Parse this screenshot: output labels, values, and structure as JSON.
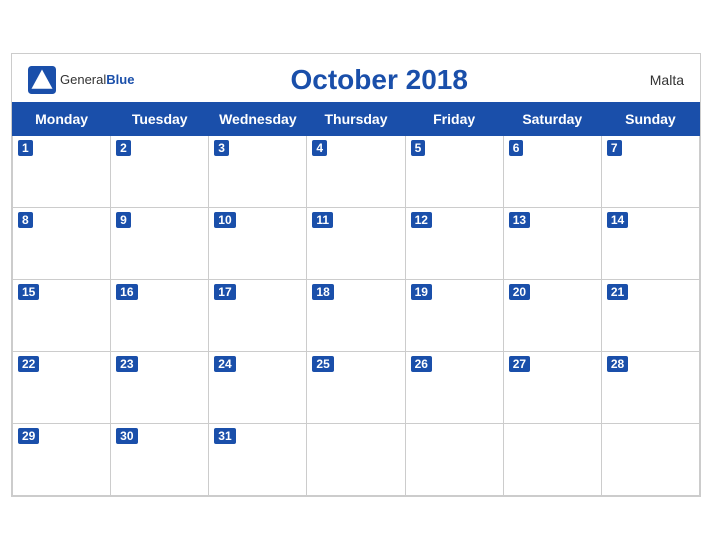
{
  "header": {
    "logo_general": "General",
    "logo_blue": "Blue",
    "title": "October 2018",
    "country": "Malta"
  },
  "weekdays": [
    "Monday",
    "Tuesday",
    "Wednesday",
    "Thursday",
    "Friday",
    "Saturday",
    "Sunday"
  ],
  "weeks": [
    [
      1,
      2,
      3,
      4,
      5,
      6,
      7
    ],
    [
      8,
      9,
      10,
      11,
      12,
      13,
      14
    ],
    [
      15,
      16,
      17,
      18,
      19,
      20,
      21
    ],
    [
      22,
      23,
      24,
      25,
      26,
      27,
      28
    ],
    [
      29,
      30,
      31,
      null,
      null,
      null,
      null
    ]
  ]
}
